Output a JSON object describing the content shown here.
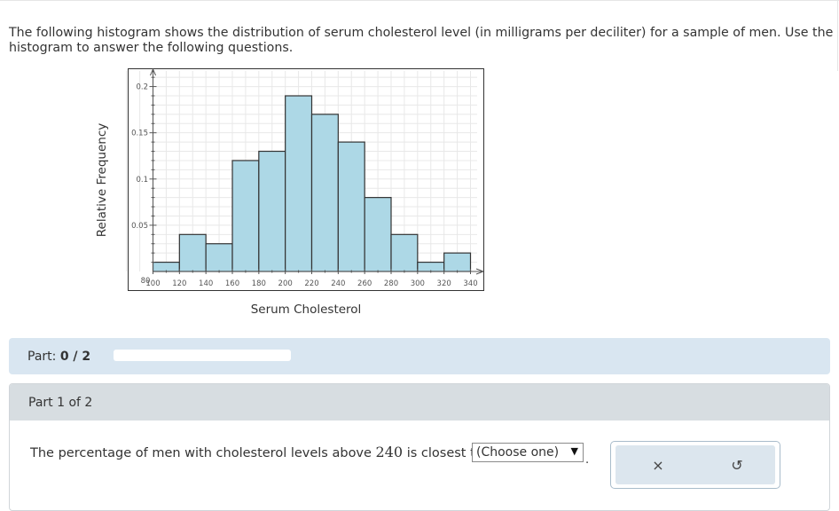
{
  "question": {
    "text": "The following histogram shows the distribution of serum cholesterol level (in milligrams per deciliter) for a sample of men. Use the histogram to answer the following questions."
  },
  "chart_data": {
    "type": "bar",
    "histogram": true,
    "bin_edges": [
      100,
      120,
      140,
      160,
      180,
      200,
      220,
      240,
      260,
      280,
      300,
      320,
      340
    ],
    "values": [
      0.01,
      0.04,
      0.03,
      0.12,
      0.13,
      0.19,
      0.17,
      0.14,
      0.08,
      0.04,
      0.01,
      0.02
    ],
    "xlabel": "Serum Cholesterol",
    "ylabel": "Relative Frequency",
    "xlim": [
      80,
      340
    ],
    "ylim": [
      0,
      0.21
    ],
    "x_tick_labels": [
      "80",
      "100",
      "120",
      "140",
      "160",
      "180",
      "200",
      "220",
      "240",
      "260",
      "280",
      "300",
      "320",
      "340"
    ],
    "y_tick_labels": [
      "0.05",
      "0.1",
      "0.15",
      "0.2"
    ],
    "y_tick_values": [
      0.05,
      0.1,
      0.15,
      0.2
    ],
    "grid": true,
    "bar_color": "#add8e6",
    "edge_color": "#333333"
  },
  "progress": {
    "label": "Part:",
    "value_text": "0 / 2",
    "fraction": 0
  },
  "part": {
    "title": "Part 1 of 2",
    "prompt_before": "The percentage of men with cholesterol levels above ",
    "prompt_number": "240",
    "prompt_after": " is closest to",
    "select_value": "(Choose one)",
    "trailing": "."
  },
  "tools": {
    "clear_icon": "×",
    "undo_icon": "↺"
  },
  "colors": {
    "part_bar": "#d9e6f1",
    "part_header": "#d7dde1",
    "tools_bg": "#dce6ee"
  }
}
